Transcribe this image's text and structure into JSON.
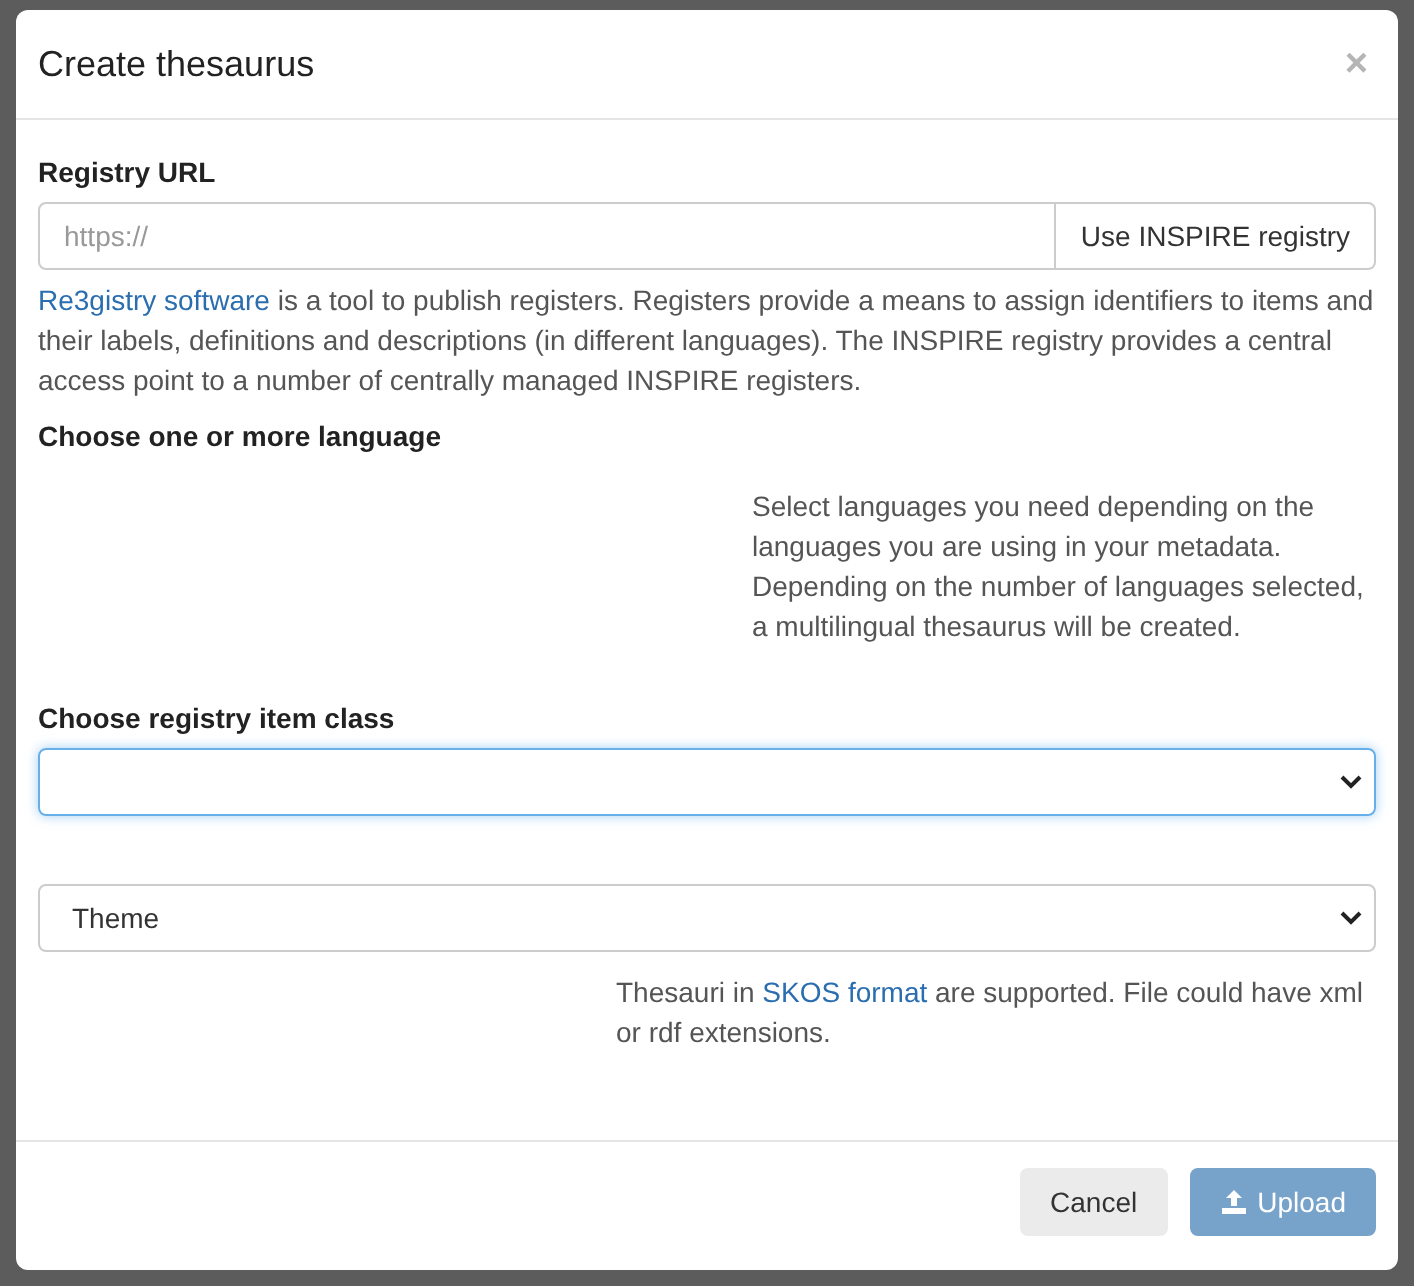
{
  "dialog": {
    "title": "Create thesaurus",
    "close": "×"
  },
  "registry_url": {
    "label": "Registry URL",
    "placeholder": "https://",
    "button": "Use INSPIRE registry"
  },
  "description": {
    "link": "Re3gistry software",
    "text": " is a tool to publish registers. Registers provide a means to assign identifiers to items and their labels, definitions and descriptions (in different languages). The INSPIRE registry provides a central access point to a number of centrally managed INSPIRE registers."
  },
  "languages": {
    "label": "Choose one or more language",
    "help": "Select languages you need depending on the languages you are using in your metadata. Depending on the number of languages selected, a multilingual thesaurus will be created."
  },
  "item_class": {
    "label": "Choose registry item class",
    "focused": true
  },
  "type_select": {
    "value": "Theme",
    "focused": false
  },
  "format_help": {
    "before": "Thesauri in ",
    "link": "SKOS format",
    "after": " are supported. File could have xml or rdf extensions."
  },
  "footer": {
    "buttons": [
      {
        "label": "Cancel",
        "kind": "default",
        "disabled": false
      },
      {
        "label": "Upload",
        "kind": "primary",
        "disabled": true
      }
    ]
  }
}
